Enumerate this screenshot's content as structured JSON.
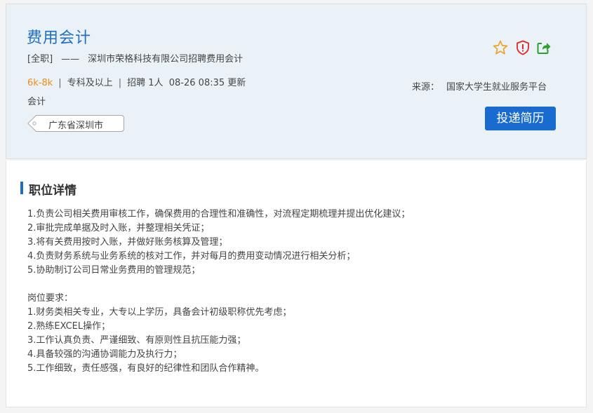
{
  "job": {
    "title": "费用会计",
    "type": "[全职]",
    "dash": "——",
    "company_line": "深圳市荣格科技有限公司招聘费用会计",
    "salary": "6k-8k",
    "bar": "|",
    "education": "专科及以上",
    "headcount": "招聘 1人",
    "updated": "08-26 08:35 更新",
    "category": "会计",
    "location": "广东省深圳市"
  },
  "actions": {
    "favorite_icon": "star-icon",
    "report_icon": "shield-alert-icon",
    "share_icon": "share-icon",
    "apply_label": "投递简历"
  },
  "source": {
    "label": "来源：",
    "name": "国家大学生就业服务平台"
  },
  "colors": {
    "accent": "#1f6ec6",
    "salary": "#f08c18",
    "apply_button": "#1a6bd0",
    "star": "#f0a020",
    "shield": "#e0262b",
    "share": "#2ca02c"
  },
  "details": {
    "section_title": "职位详情",
    "duties": [
      "1.负责公司相关费用审核工作，确保费用的合理性和准确性，对流程定期梳理并提出优化建议；",
      "2.审批完成单据及时入账，并整理相关凭证；",
      "3.将有关费用按时入账，并做好账务核算及管理；",
      "4.负责财务系统与业务系统的核对工作，并对每月的费用变动情况进行相关分析；",
      "5.协助制订公司日常业务费用的管理规范；"
    ],
    "requirements_title": "岗位要求：",
    "requirements": [
      "1.财务类相关专业，大专以上学历，具备会计初级职称优先考虑；",
      "2.熟练EXCEL操作；",
      "3.工作认真负责、严谨细致、有原则性且抗压能力强；",
      "4.具备较强的沟通协调能力及执行力；",
      "5.工作细致，责任感强，有良好的纪律性和团队合作精神。"
    ]
  }
}
